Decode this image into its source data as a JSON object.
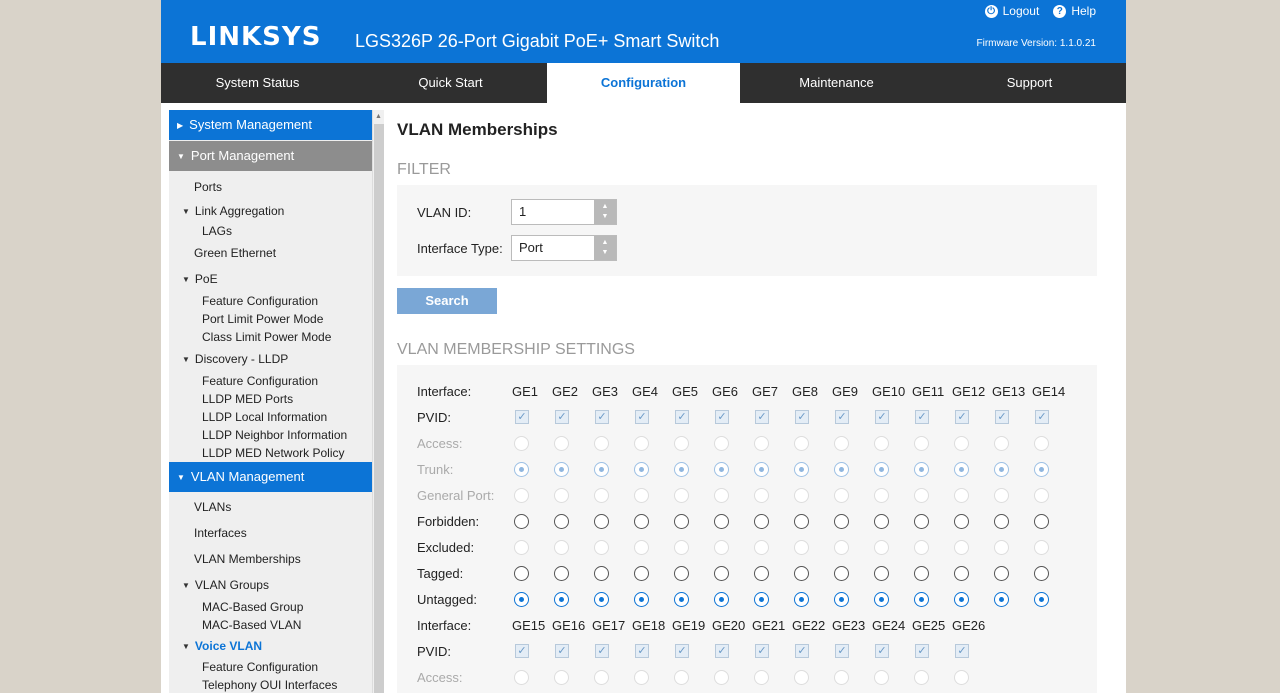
{
  "header": {
    "logo": "LINKSYS",
    "product": "LGS326P 26-Port Gigabit PoE+ Smart Switch",
    "logout_label": "Logout",
    "help_label": "Help",
    "firmware": "Firmware Version: 1.1.0.21"
  },
  "nav": {
    "tabs": [
      "System Status",
      "Quick Start",
      "Configuration",
      "Maintenance",
      "Support"
    ],
    "active": "Configuration"
  },
  "sidebar": {
    "system_management": "System Management",
    "port_management": "Port Management",
    "ports": "Ports",
    "link_aggregation": "Link Aggregation",
    "lags": "LAGs",
    "green_ethernet": "Green Ethernet",
    "poe": "PoE",
    "poe_feature_configuration": "Feature Configuration",
    "port_limit_power_mode": "Port Limit Power Mode",
    "class_limit_power_mode": "Class Limit Power Mode",
    "discovery_lldp": "Discovery - LLDP",
    "lldp_feature_configuration": "Feature Configuration",
    "lldp_med_ports": "LLDP MED Ports",
    "lldp_local_information": "LLDP Local Information",
    "lldp_neighbor_information": "LLDP Neighbor Information",
    "lldp_med_network_policy": "LLDP MED Network Policy",
    "vlan_management": "VLAN Management",
    "vlans": "VLANs",
    "interfaces": "Interfaces",
    "vlan_memberships": "VLAN Memberships",
    "vlan_groups": "VLAN Groups",
    "mac_based_group": "MAC-Based Group",
    "mac_based_vlan": "MAC-Based VLAN",
    "voice_vlan": "Voice VLAN",
    "voice_feature_configuration": "Feature Configuration",
    "telephony_oui_interfaces": "Telephony OUI Interfaces"
  },
  "main": {
    "title": "VLAN Memberships",
    "filter_heading": "FILTER",
    "vlan_id_label": "VLAN ID:",
    "vlan_id_value": "1",
    "interface_type_label": "Interface Type:",
    "interface_type_value": "Port",
    "search_label": "Search",
    "settings_heading": "VLAN MEMBERSHIP SETTINGS"
  },
  "membership": {
    "row_labels": {
      "interface": "Interface:",
      "pvid": "PVID:",
      "access": "Access:",
      "trunk": "Trunk:",
      "general_port": "General Port:",
      "forbidden": "Forbidden:",
      "excluded": "Excluded:",
      "tagged": "Tagged:",
      "untagged": "Untagged:"
    },
    "group1_ports": [
      "GE1",
      "GE2",
      "GE3",
      "GE4",
      "GE5",
      "GE6",
      "GE7",
      "GE8",
      "GE9",
      "GE10",
      "GE11",
      "GE12",
      "GE13",
      "GE14"
    ],
    "group2_ports": [
      "GE15",
      "GE16",
      "GE17",
      "GE18",
      "GE19",
      "GE20",
      "GE21",
      "GE22",
      "GE23",
      "GE24",
      "GE25",
      "GE26"
    ],
    "pvid_checked": true,
    "port_mode": "Trunk",
    "membership": "Untagged"
  },
  "colors": {
    "brand_blue": "#0c74d6",
    "nav_dark": "#2f2f2f",
    "background": "#d9d3c9"
  },
  "icons": {
    "logout": "power-icon",
    "help": "question-icon"
  }
}
